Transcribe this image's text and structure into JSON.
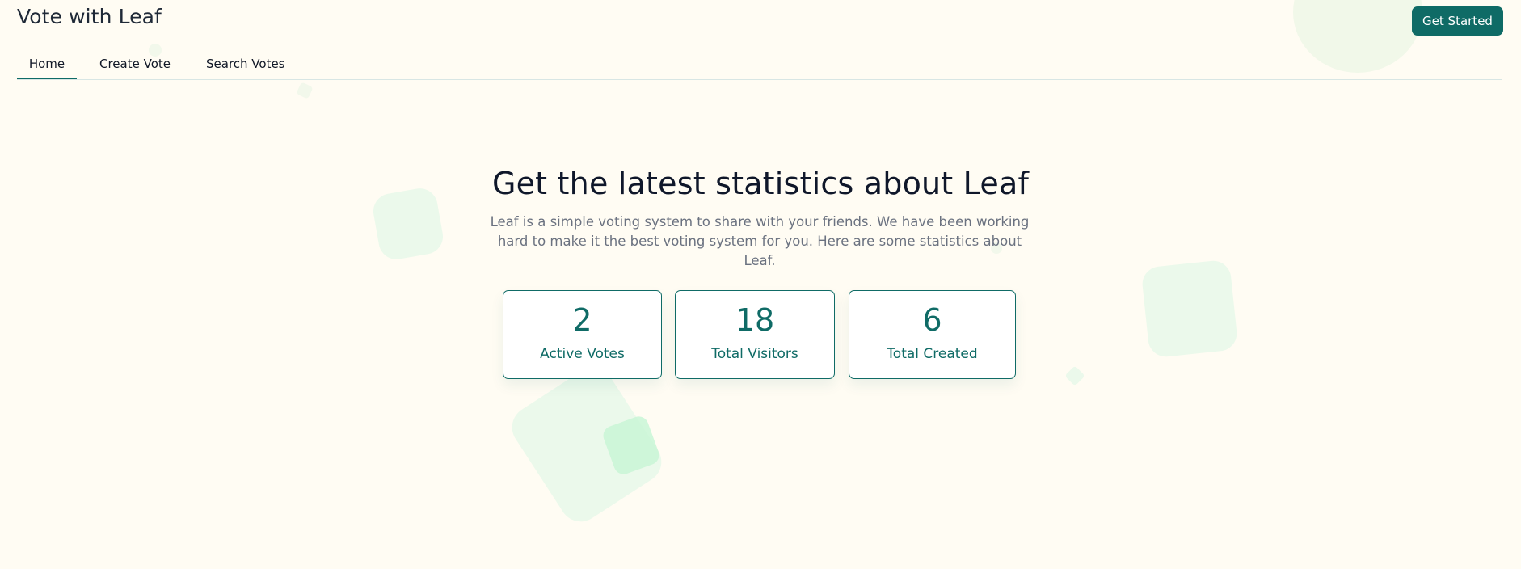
{
  "header": {
    "title": "Vote with Leaf",
    "cta_label": "Get Started"
  },
  "tabs": [
    {
      "label": "Home",
      "active": true
    },
    {
      "label": "Create Vote",
      "active": false
    },
    {
      "label": "Search Votes",
      "active": false
    }
  ],
  "hero": {
    "title": "Get the latest statistics about Leaf",
    "description": "Leaf is a simple voting system to share with your friends. We have been working hard to make it the best voting system for you. Here are some statistics about Leaf."
  },
  "stats": [
    {
      "value": "2",
      "label": "Active Votes"
    },
    {
      "value": "18",
      "label": "Total Visitors"
    },
    {
      "value": "6",
      "label": "Total Created"
    }
  ],
  "colors": {
    "brand": "#0f6b66",
    "background": "#fffcf3",
    "decor": "#e4f8e8"
  }
}
